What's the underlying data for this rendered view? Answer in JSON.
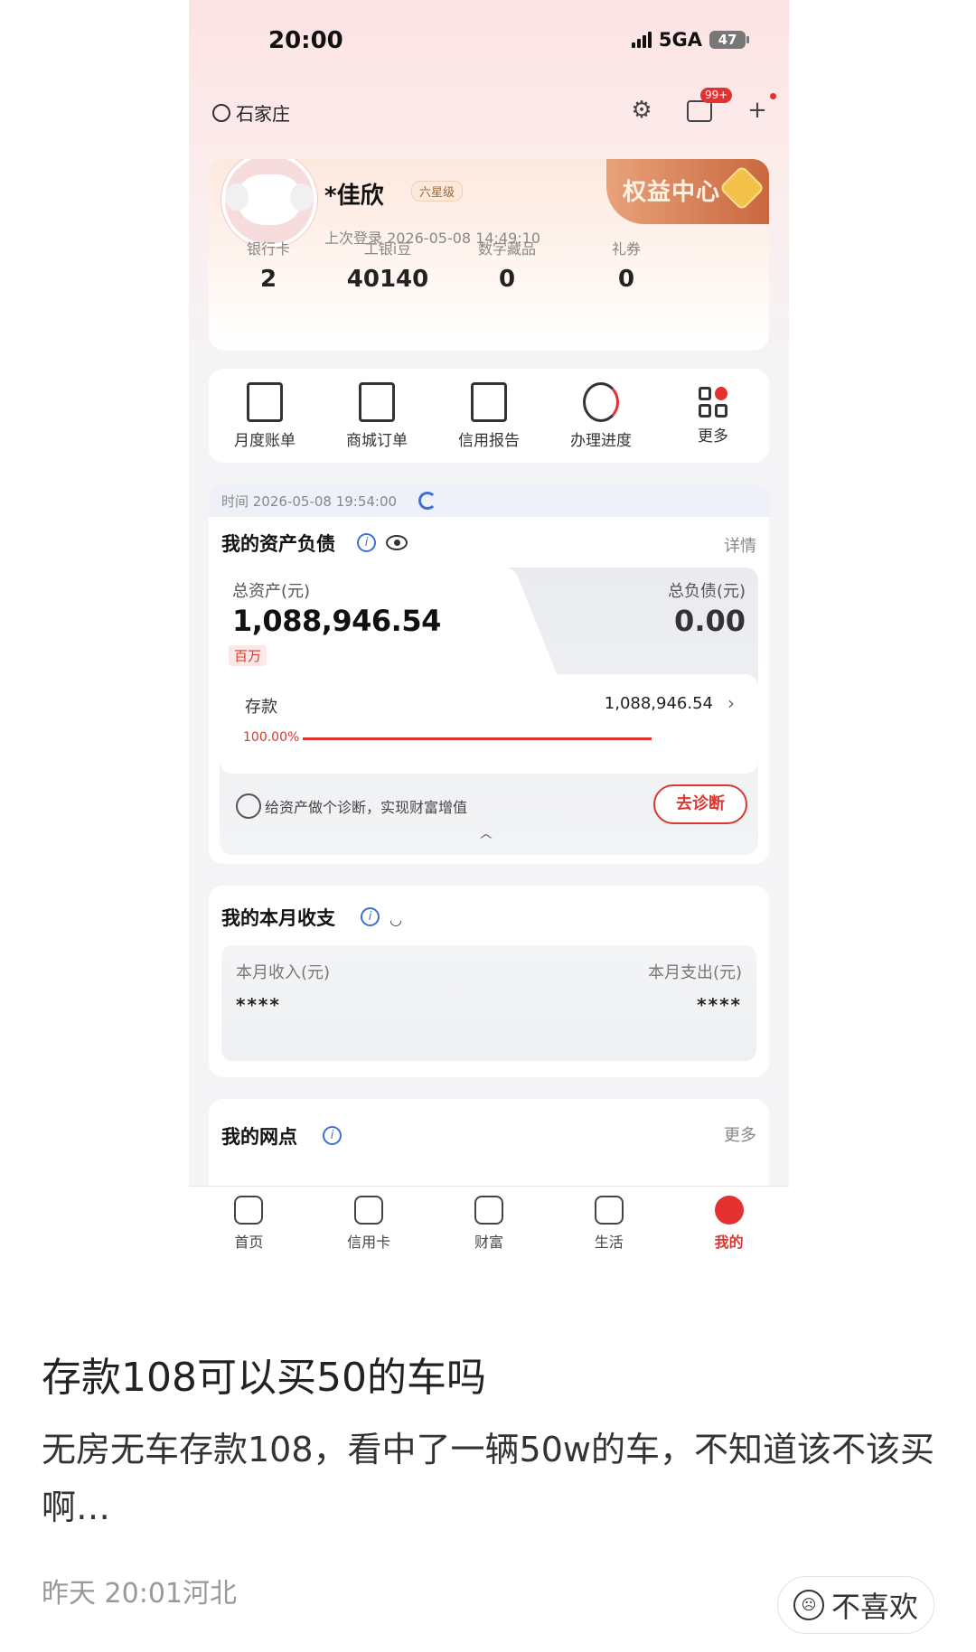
{
  "status_bar": {
    "time": "20:00",
    "network": "5GA",
    "battery": "47"
  },
  "header": {
    "location": "石家庄",
    "message_badge": "99+"
  },
  "user_card": {
    "name": "*佳欣",
    "level": "六星级",
    "last_login": "上次登录 2026-05-08 14:49:10",
    "rights_center": "权益中心",
    "stats": [
      {
        "label": "银行卡",
        "value": "2"
      },
      {
        "label": "工银i豆",
        "value": "40140"
      },
      {
        "label": "数字藏品",
        "value": "0"
      },
      {
        "label": "礼券",
        "value": "0"
      }
    ]
  },
  "quick_menu": [
    {
      "label": "月度账单",
      "icon": "monthly-bill-icon"
    },
    {
      "label": "商城订单",
      "icon": "mall-order-icon"
    },
    {
      "label": "信用报告",
      "icon": "credit-report-icon"
    },
    {
      "label": "办理进度",
      "icon": "progress-pie-icon"
    },
    {
      "label": "更多",
      "icon": "grid-more-icon"
    }
  ],
  "assets": {
    "time": "时间 2026-05-08 19:54:00",
    "title": "我的资产负债",
    "detail": "详情",
    "total_assets_label": "总资产(元)",
    "total_assets_value": "1,088,946.54",
    "million_tag": "百万",
    "total_debt_label": "总负债(元)",
    "total_debt_value": "0.00",
    "deposit_label": "存款",
    "deposit_value": "1,088,946.54",
    "deposit_percent": "100.00%",
    "diagnosis_text": "给资产做个诊断，实现财富增值",
    "diagnosis_button": "去诊断"
  },
  "income": {
    "title": "我的本月收支",
    "income_label": "本月收入(元)",
    "income_value": "****",
    "expense_label": "本月支出(元)",
    "expense_value": "****"
  },
  "branch": {
    "title": "我的网点",
    "more": "更多"
  },
  "tabbar": [
    {
      "label": "首页",
      "icon": "home-icon"
    },
    {
      "label": "信用卡",
      "icon": "credit-card-icon"
    },
    {
      "label": "财富",
      "icon": "wealth-chart-icon"
    },
    {
      "label": "生活",
      "icon": "life-ticket-icon"
    },
    {
      "label": "我的",
      "icon": "profile-icon"
    }
  ],
  "post": {
    "title": "存款108可以买50的车吗",
    "body": "无房无车存款108，看中了一辆50w的车，不知道该不该买啊…",
    "meta": "昨天 20:01河北",
    "dislike": "不喜欢"
  }
}
